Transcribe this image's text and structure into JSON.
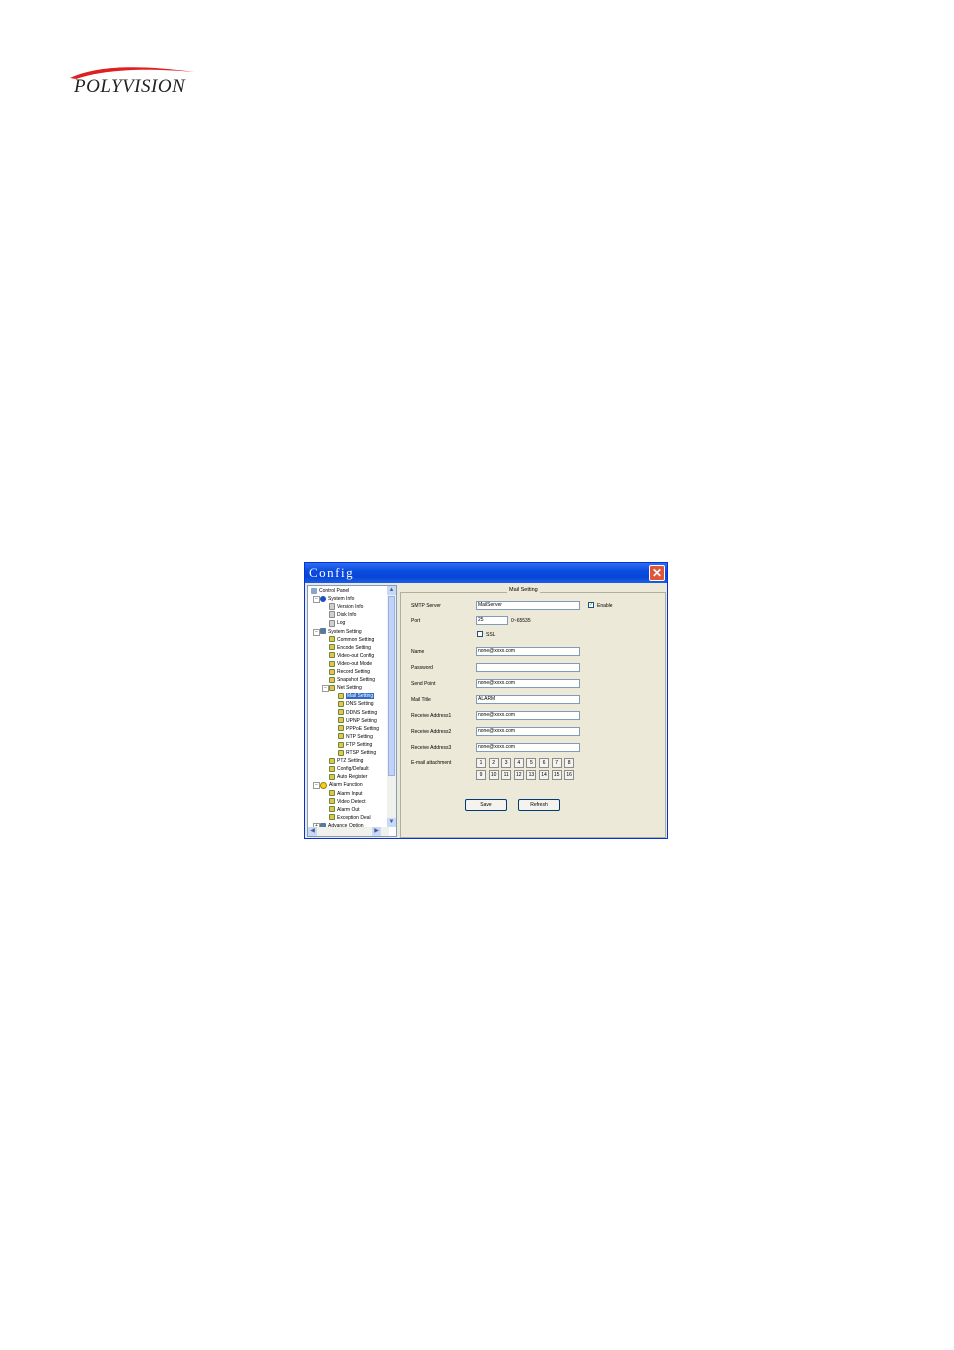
{
  "logo": {
    "text": "POLYVISION"
  },
  "window": {
    "title": "Config",
    "close_label": "✕"
  },
  "tree": {
    "items": [
      {
        "label": "Control Panel",
        "depth": 0,
        "icon": "root"
      },
      {
        "label": "System Info",
        "depth": 1,
        "icon": "info",
        "expander": "−"
      },
      {
        "label": "Version Info",
        "depth": 2,
        "icon": "doc"
      },
      {
        "label": "Disk Info",
        "depth": 2,
        "icon": "doc"
      },
      {
        "label": "Log",
        "depth": 2,
        "icon": "doc"
      },
      {
        "label": "System Setting",
        "depth": 1,
        "icon": "sys",
        "expander": "−"
      },
      {
        "label": "Common Setting",
        "depth": 2,
        "icon": "item"
      },
      {
        "label": "Encode Setting",
        "depth": 2,
        "icon": "item"
      },
      {
        "label": "Video-out Config",
        "depth": 2,
        "icon": "item"
      },
      {
        "label": "Video-out Mode",
        "depth": 2,
        "icon": "item"
      },
      {
        "label": "Record Setting",
        "depth": 2,
        "icon": "item"
      },
      {
        "label": "Snapshot Setting",
        "depth": 2,
        "icon": "item"
      },
      {
        "label": "Net Setting",
        "depth": 2,
        "icon": "item",
        "expander": "−"
      },
      {
        "label": "Mail Setting",
        "depth": 3,
        "icon": "item",
        "selected": true
      },
      {
        "label": "DNS Setting",
        "depth": 3,
        "icon": "item"
      },
      {
        "label": "DDNS Setting",
        "depth": 3,
        "icon": "item"
      },
      {
        "label": "UPNP Setting",
        "depth": 3,
        "icon": "item"
      },
      {
        "label": "PPPoE Setting",
        "depth": 3,
        "icon": "item"
      },
      {
        "label": "NTP Setting",
        "depth": 3,
        "icon": "item"
      },
      {
        "label": "FTP Setting",
        "depth": 3,
        "icon": "item"
      },
      {
        "label": "RTSP Setting",
        "depth": 3,
        "icon": "item"
      },
      {
        "label": "PTZ Setting",
        "depth": 2,
        "icon": "item"
      },
      {
        "label": "Config/Default",
        "depth": 2,
        "icon": "item"
      },
      {
        "label": "Auto Register",
        "depth": 2,
        "icon": "item"
      },
      {
        "label": "Alarm Function",
        "depth": 1,
        "icon": "alarm",
        "expander": "−"
      },
      {
        "label": "Alarm Input",
        "depth": 2,
        "icon": "item"
      },
      {
        "label": "Video Detect",
        "depth": 2,
        "icon": "item"
      },
      {
        "label": "Alarm Out",
        "depth": 2,
        "icon": "item"
      },
      {
        "label": "Exception Deal",
        "depth": 2,
        "icon": "item"
      },
      {
        "label": "Advance Option",
        "depth": 1,
        "icon": "sys",
        "expander": "+"
      }
    ]
  },
  "mail": {
    "group_title": "Mail Setting",
    "smtp_label": "SMTP Server",
    "smtp_value": "MailServer",
    "enable_label": "Enable",
    "enable_checked": "✓",
    "port_label": "Port",
    "port_value": "25",
    "port_range": "0~65535",
    "ssl_label": "SSL",
    "name_label": "Name",
    "name_value": "none@xxxx.com",
    "password_label": "Password",
    "password_value": "",
    "send_point_label": "Send Point",
    "send_point_value": "none@xxxx.com",
    "mail_title_label": "Mail Title",
    "mail_title_value": "ALARM",
    "recv1_label": "Receive Address1",
    "recv1_value": "none@xxxx.com",
    "recv2_label": "Receive Address2",
    "recv2_value": "none@xxxx.com",
    "recv3_label": "Receive Address3",
    "recv3_value": "none@xxxx.com",
    "attach_label": "E-mail attachment",
    "attach_buttons": [
      "1",
      "2",
      "3",
      "4",
      "5",
      "6",
      "7",
      "8",
      "9",
      "10",
      "11",
      "12",
      "13",
      "14",
      "15",
      "16"
    ],
    "save_label": "Save",
    "refresh_label": "Refresh"
  }
}
